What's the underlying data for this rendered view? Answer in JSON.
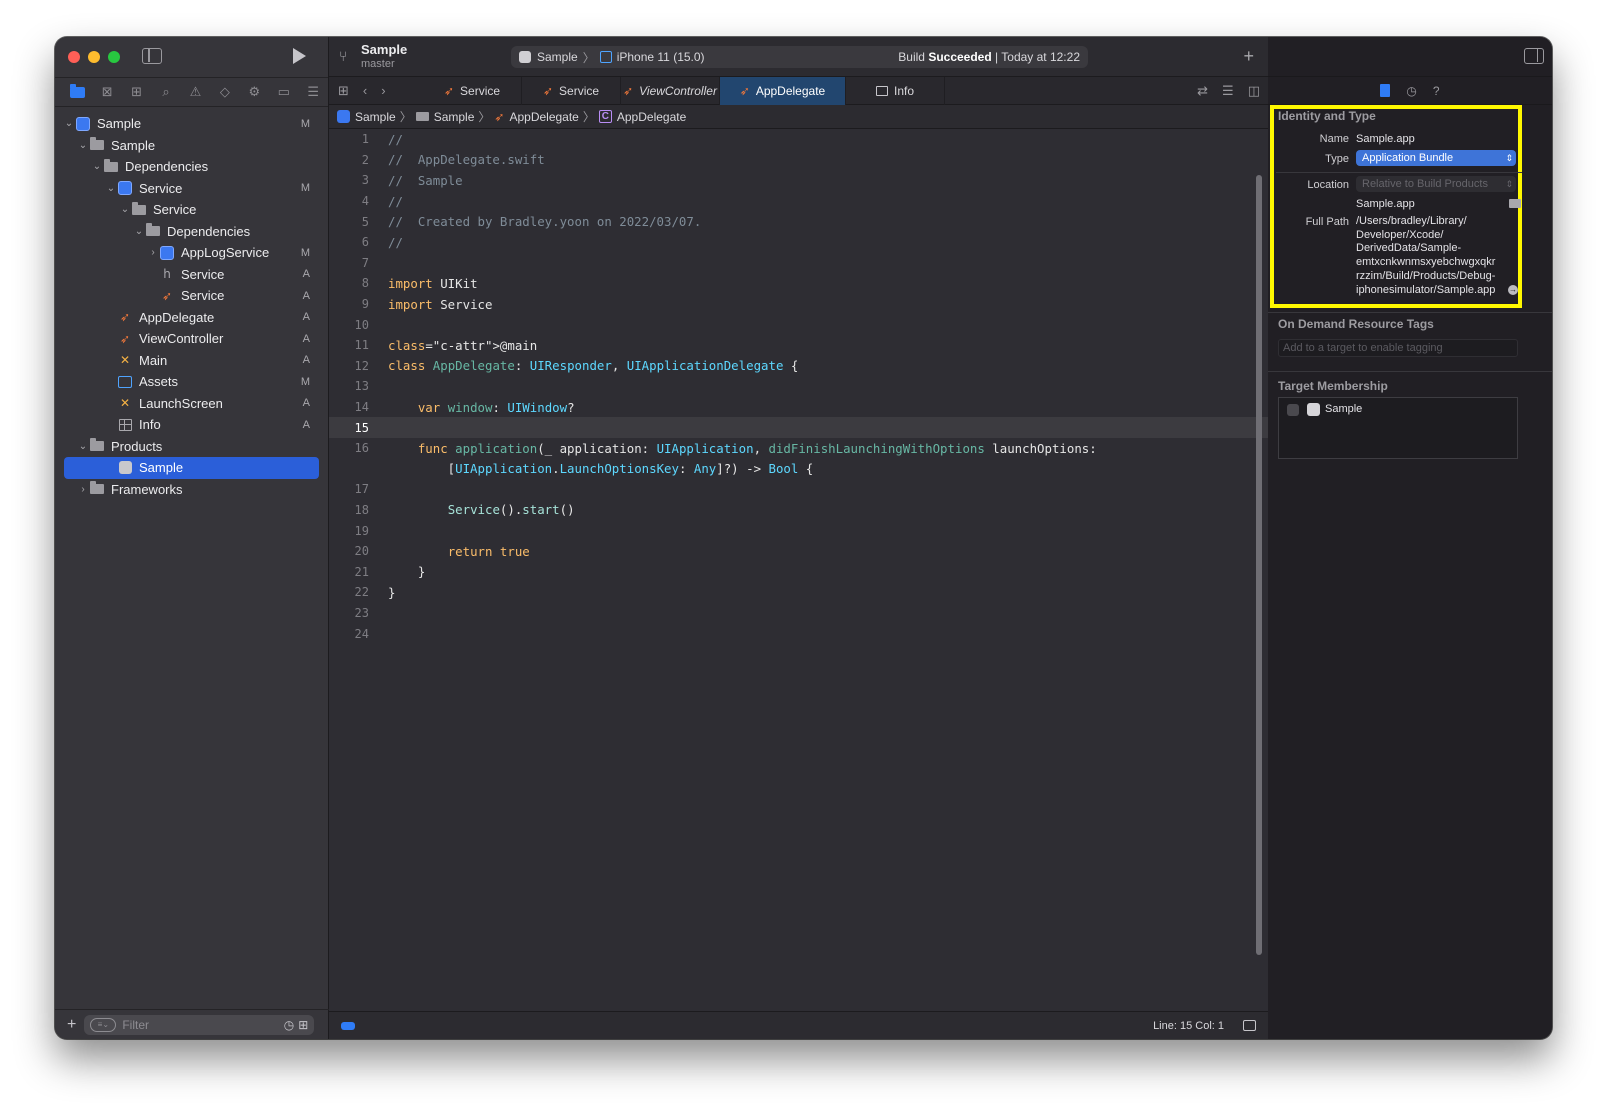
{
  "navigator": {
    "tabs": [
      "folder-icon",
      "source-control-icon",
      "symbol-icon",
      "search-icon",
      "warning-icon",
      "test-icon",
      "debug-icon",
      "breakpoint-icon",
      "report-icon"
    ],
    "tree": [
      {
        "label": "Sample",
        "badge": "M",
        "icon": "project"
      },
      {
        "label": "Sample",
        "badge": "",
        "icon": "folder"
      },
      {
        "label": "Dependencies",
        "badge": "",
        "icon": "folder"
      },
      {
        "label": "Service",
        "badge": "M",
        "icon": "project"
      },
      {
        "label": "Service",
        "badge": "",
        "icon": "folder"
      },
      {
        "label": "Dependencies",
        "badge": "",
        "icon": "folder"
      },
      {
        "label": "AppLogService",
        "badge": "M",
        "icon": "project"
      },
      {
        "label": "Service",
        "badge": "A",
        "icon": "header"
      },
      {
        "label": "Service",
        "badge": "A",
        "icon": "swift"
      },
      {
        "label": "AppDelegate",
        "badge": "A",
        "icon": "swift"
      },
      {
        "label": "ViewController",
        "badge": "A",
        "icon": "swift"
      },
      {
        "label": "Main",
        "badge": "A",
        "icon": "storyboard"
      },
      {
        "label": "Assets",
        "badge": "M",
        "icon": "assets"
      },
      {
        "label": "LaunchScreen",
        "badge": "A",
        "icon": "storyboard"
      },
      {
        "label": "Info",
        "badge": "A",
        "icon": "plist"
      },
      {
        "label": "Products",
        "badge": "",
        "icon": "folder"
      },
      {
        "label": "Sample",
        "badge": "",
        "icon": "app"
      },
      {
        "label": "Frameworks",
        "badge": "",
        "icon": "folder"
      }
    ],
    "filter_placeholder": "Filter"
  },
  "toolbar": {
    "project": "Sample",
    "branch": "master",
    "scheme": "Sample",
    "device": "iPhone 11 (15.0)",
    "build_word": "Build",
    "build_result": "Succeeded",
    "build_time": "| Today at 12:22"
  },
  "tabs": [
    {
      "label": "Service",
      "type": "swift",
      "active": false,
      "italic": false
    },
    {
      "label": "Service",
      "type": "swift",
      "active": false,
      "italic": false
    },
    {
      "label": "ViewController",
      "type": "swift",
      "active": false,
      "italic": true
    },
    {
      "label": "AppDelegate",
      "type": "swift",
      "active": true,
      "italic": false
    },
    {
      "label": "Info",
      "type": "plist",
      "active": false,
      "italic": false
    }
  ],
  "jumpbar": [
    "Sample",
    "Sample",
    "AppDelegate",
    "AppDelegate"
  ],
  "code": [
    "//",
    "//  AppDelegate.swift",
    "//  Sample",
    "//",
    "//  Created by Bradley.yoon on 2022/03/07.",
    "//",
    "",
    "import UIKit",
    "import Service",
    "",
    "@main",
    "class AppDelegate: UIResponder, UIApplicationDelegate {",
    "",
    "    var window: UIWindow?",
    "",
    "    func application(_ application: UIApplication, didFinishLaunchingWithOptions launchOptions:",
    "        [UIApplication.LaunchOptionsKey: Any]?) -> Bool {",
    "",
    "        Service().start()",
    "",
    "        return true",
    "    }",
    "}",
    "",
    ""
  ],
  "current_line": 15,
  "status": {
    "line_col": "Line: 15  Col: 1"
  },
  "inspector": {
    "identity_title": "Identity and Type",
    "name_label": "Name",
    "name_value": "Sample.app",
    "type_label": "Type",
    "type_value": "Application Bundle",
    "location_label": "Location",
    "location_value": "Relative to Build Products",
    "location_file": "Sample.app",
    "fullpath_label": "Full Path",
    "fullpath_lines": [
      "/Users/bradley/Library/",
      "Developer/Xcode/",
      "DerivedData/Sample-",
      "emtxcnkwnmsxyebchwgxqkr",
      "rzzim/Build/Products/Debug-",
      "iphonesimulator/Sample.app"
    ],
    "ondemand_title": "On Demand Resource Tags",
    "ondemand_placeholder": "Add to a target to enable tagging",
    "membership_title": "Target Membership",
    "membership_target": "Sample"
  },
  "colors": {
    "highlight_box": "#fff800",
    "accent": "#2f7cf6",
    "selected_row": "#2b5fd9"
  }
}
